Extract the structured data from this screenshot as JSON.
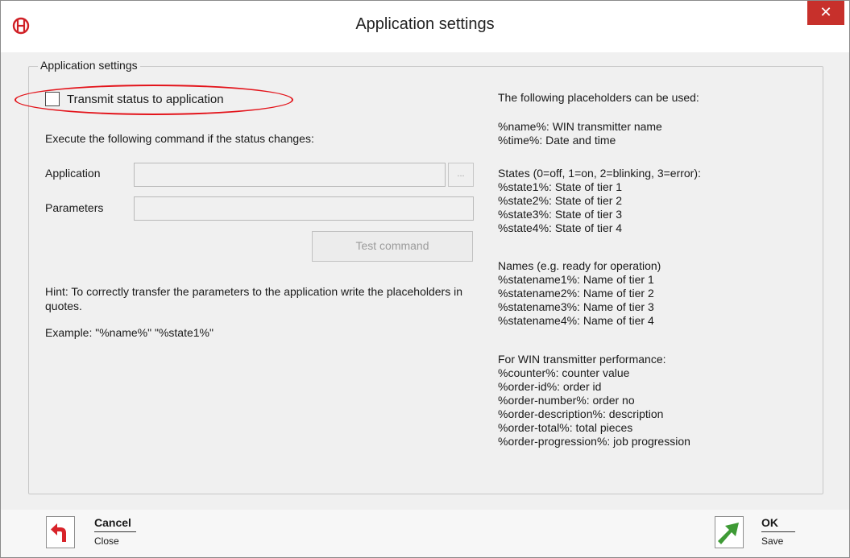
{
  "window": {
    "title": "Application settings",
    "close_symbol": "✕",
    "logo_icon": "company-logo-icon"
  },
  "group": {
    "legend": "Application settings"
  },
  "form": {
    "transmit_checkbox_label": "Transmit status to application",
    "transmit_checked": false,
    "execute_label": "Execute the following command if the status changes:",
    "application_label": "Application",
    "application_value": "",
    "browse_label": "...",
    "parameters_label": "Parameters",
    "parameters_value": "",
    "test_button": "Test command",
    "hint_text": "Hint: To correctly transfer the parameters to the application write the placeholders in quotes.",
    "example_text": "Example: \"%name%\" \"%state1%\""
  },
  "placeholders": {
    "heading": "The following placeholders can be used:",
    "general": "%name%: WIN transmitter name\n%time%: Date and time",
    "states": "States (0=off, 1=on, 2=blinking, 3=error):\n%state1%: State of tier 1\n%state2%: State of tier 2\n%state3%: State of tier 3\n%state4%: State of tier 4",
    "names": "Names (e.g. ready for operation)\n%statename1%: Name of tier 1\n%statename2%: Name of tier 2\n%statename3%: Name of tier 3\n%statename4%: Name of tier 4",
    "performance": "For WIN transmitter performance:\n%counter%: counter value\n%order-id%: order id\n%order-number%: order no\n%order-description%: description\n%order-total%: total pieces\n%order-progression%: job progression"
  },
  "footer": {
    "cancel_label": "Cancel",
    "cancel_sub": "Close",
    "ok_label": "OK",
    "ok_sub": "Save"
  },
  "colors": {
    "highlight": "#e3131a",
    "close_button": "#c7302b",
    "cancel_icon": "#d8232a",
    "ok_icon": "#3e9a35"
  }
}
